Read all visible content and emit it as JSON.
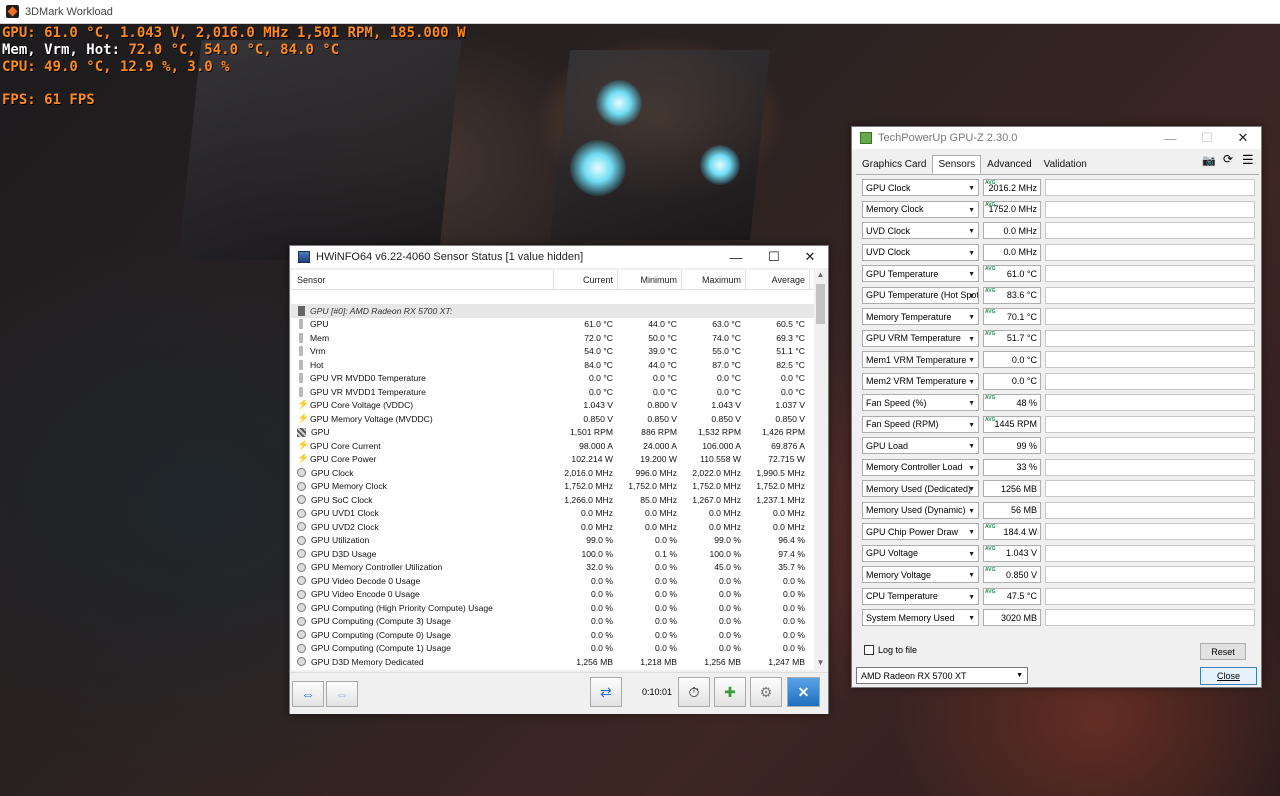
{
  "game_window": {
    "title": "3DMark Workload"
  },
  "osd": {
    "gpu_line": "GPU: 61.0 °C, 1.043 V, 2,016.0 MHz 1,501 RPM, 185.000 W",
    "mem_label": "Mem, Vrm, Hot:",
    "mem_values": " 72.0 °C, 54.0 °C, 84.0 °C",
    "cpu_line": "CPU: 49.0 °C, 12.9 %, 3.0 %",
    "fps_line": "FPS: 61 FPS"
  },
  "hwinfo": {
    "title": "HWiNFO64 v6.22-4060 Sensor Status [1 value hidden]",
    "columns": [
      "Sensor",
      "Current",
      "Minimum",
      "Maximum",
      "Average"
    ],
    "group": "GPU [#0]: AMD Radeon RX 5700 XT:",
    "rows": [
      {
        "icon": "therm",
        "name": "GPU",
        "cur": "61.0 °C",
        "min": "44.0 °C",
        "max": "63.0 °C",
        "avg": "60.5 °C"
      },
      {
        "icon": "therm",
        "name": "Mem",
        "cur": "72.0 °C",
        "min": "50.0 °C",
        "max": "74.0 °C",
        "avg": "69.3 °C"
      },
      {
        "icon": "therm",
        "name": "Vrm",
        "cur": "54.0 °C",
        "min": "39.0 °C",
        "max": "55.0 °C",
        "avg": "51.1 °C"
      },
      {
        "icon": "therm",
        "name": "Hot",
        "cur": "84.0 °C",
        "min": "44.0 °C",
        "max": "87.0 °C",
        "avg": "82.5 °C"
      },
      {
        "icon": "therm",
        "name": "GPU VR MVDD0 Temperature",
        "cur": "0.0 °C",
        "min": "0.0 °C",
        "max": "0.0 °C",
        "avg": "0.0 °C"
      },
      {
        "icon": "therm",
        "name": "GPU VR MVDD1 Temperature",
        "cur": "0.0 °C",
        "min": "0.0 °C",
        "max": "0.0 °C",
        "avg": "0.0 °C"
      },
      {
        "icon": "bolt",
        "name": "GPU Core Voltage (VDDC)",
        "cur": "1.043 V",
        "min": "0.800 V",
        "max": "1.043 V",
        "avg": "1.037 V"
      },
      {
        "icon": "bolt",
        "name": "GPU Memory Voltage (MVDDC)",
        "cur": "0.850 V",
        "min": "0.850 V",
        "max": "0.850 V",
        "avg": "0.850 V"
      },
      {
        "icon": "fan",
        "name": "GPU",
        "cur": "1,501 RPM",
        "min": "886 RPM",
        "max": "1,532 RPM",
        "avg": "1,426 RPM"
      },
      {
        "icon": "bolt",
        "name": "GPU Core Current",
        "cur": "98.000 A",
        "min": "24.000 A",
        "max": "106.000 A",
        "avg": "69.876 A"
      },
      {
        "icon": "bolt",
        "name": "GPU Core Power",
        "cur": "102.214 W",
        "min": "19.200 W",
        "max": "110.558 W",
        "avg": "72.715 W"
      },
      {
        "icon": "clock",
        "name": "GPU Clock",
        "cur": "2,016.0 MHz",
        "min": "996.0 MHz",
        "max": "2,022.0 MHz",
        "avg": "1,990.5 MHz"
      },
      {
        "icon": "clock",
        "name": "GPU Memory Clock",
        "cur": "1,752.0 MHz",
        "min": "1,752.0 MHz",
        "max": "1,752.0 MHz",
        "avg": "1,752.0 MHz"
      },
      {
        "icon": "clock",
        "name": "GPU SoC Clock",
        "cur": "1,266.0 MHz",
        "min": "85.0 MHz",
        "max": "1,267.0 MHz",
        "avg": "1,237.1 MHz"
      },
      {
        "icon": "clock",
        "name": "GPU UVD1 Clock",
        "cur": "0.0 MHz",
        "min": "0.0 MHz",
        "max": "0.0 MHz",
        "avg": "0.0 MHz"
      },
      {
        "icon": "clock",
        "name": "GPU UVD2 Clock",
        "cur": "0.0 MHz",
        "min": "0.0 MHz",
        "max": "0.0 MHz",
        "avg": "0.0 MHz"
      },
      {
        "icon": "clock",
        "name": "GPU Utilization",
        "cur": "99.0 %",
        "min": "0.0 %",
        "max": "99.0 %",
        "avg": "96.4 %"
      },
      {
        "icon": "clock",
        "name": "GPU D3D Usage",
        "cur": "100.0 %",
        "min": "0.1 %",
        "max": "100.0 %",
        "avg": "97.4 %"
      },
      {
        "icon": "clock",
        "name": "GPU Memory Controller Utilization",
        "cur": "32.0 %",
        "min": "0.0 %",
        "max": "45.0 %",
        "avg": "35.7 %"
      },
      {
        "icon": "clock",
        "name": "GPU Video Decode 0 Usage",
        "cur": "0.0 %",
        "min": "0.0 %",
        "max": "0.0 %",
        "avg": "0.0 %"
      },
      {
        "icon": "clock",
        "name": "GPU Video Encode 0 Usage",
        "cur": "0.0 %",
        "min": "0.0 %",
        "max": "0.0 %",
        "avg": "0.0 %"
      },
      {
        "icon": "clock",
        "name": "GPU Computing (High Priority Compute) Usage",
        "cur": "0.0 %",
        "min": "0.0 %",
        "max": "0.0 %",
        "avg": "0.0 %"
      },
      {
        "icon": "clock",
        "name": "GPU Computing (Compute 3) Usage",
        "cur": "0.0 %",
        "min": "0.0 %",
        "max": "0.0 %",
        "avg": "0.0 %"
      },
      {
        "icon": "clock",
        "name": "GPU Computing (Compute 0) Usage",
        "cur": "0.0 %",
        "min": "0.0 %",
        "max": "0.0 %",
        "avg": "0.0 %"
      },
      {
        "icon": "clock",
        "name": "GPU Computing (Compute 1) Usage",
        "cur": "0.0 %",
        "min": "0.0 %",
        "max": "0.0 %",
        "avg": "0.0 %"
      },
      {
        "icon": "clock",
        "name": "GPU D3D Memory Dedicated",
        "cur": "1,256 MB",
        "min": "1,218 MB",
        "max": "1,256 MB",
        "avg": "1,247 MB"
      }
    ],
    "footer": {
      "timer": "0:10:01"
    }
  },
  "gpuz": {
    "title": "TechPowerUp GPU-Z 2.30.0",
    "tabs": [
      "Graphics Card",
      "Sensors",
      "Advanced",
      "Validation"
    ],
    "active_tab": 1,
    "sensors": [
      {
        "name": "GPU Clock",
        "value": "2016.2 MHz",
        "avg": true,
        "level": 0.96
      },
      {
        "name": "Memory Clock",
        "value": "1752.0 MHz",
        "avg": true,
        "level": 0.45
      },
      {
        "name": "UVD Clock",
        "value": "0.0 MHz",
        "avg": false,
        "level": 0
      },
      {
        "name": "UVD Clock",
        "value": "0.0 MHz",
        "avg": false,
        "level": 0
      },
      {
        "name": "GPU Temperature",
        "value": "61.0 °C",
        "avg": true,
        "level": 0.8
      },
      {
        "name": "GPU Temperature (Hot Spot)",
        "value": "83.6 °C",
        "avg": true,
        "level": 0.85
      },
      {
        "name": "Memory Temperature",
        "value": "70.1 °C",
        "avg": true,
        "level": 0.55
      },
      {
        "name": "GPU VRM Temperature",
        "value": "51.7 °C",
        "avg": true,
        "level": 0.3
      },
      {
        "name": "Mem1 VRM Temperature",
        "value": "0.0 °C",
        "avg": false,
        "level": 0
      },
      {
        "name": "Mem2 VRM Temperature",
        "value": "0.0 °C",
        "avg": false,
        "level": 0
      },
      {
        "name": "Fan Speed (%)",
        "value": "48 %",
        "avg": true,
        "level": 0.45
      },
      {
        "name": "Fan Speed (RPM)",
        "value": "1445 RPM",
        "avg": true,
        "level": 0.5
      },
      {
        "name": "GPU Load",
        "value": "99 %",
        "avg": false,
        "level": 0.98
      },
      {
        "name": "Memory Controller Load",
        "value": "33 %",
        "avg": false,
        "level": 0.4
      },
      {
        "name": "Memory Used (Dedicated)",
        "value": "1256 MB",
        "avg": false,
        "level": 0.15
      },
      {
        "name": "Memory Used (Dynamic)",
        "value": "56 MB",
        "avg": false,
        "level": 0.08
      },
      {
        "name": "GPU Chip Power Draw",
        "value": "184.4 W",
        "avg": true,
        "level": 0.85
      },
      {
        "name": "GPU Voltage",
        "value": "1.043 V",
        "avg": true,
        "level": 0.6
      },
      {
        "name": "Memory Voltage",
        "value": "0.850 V",
        "avg": true,
        "level": 0.35
      },
      {
        "name": "CPU Temperature",
        "value": "47.5 °C",
        "avg": true,
        "level": 0.3
      },
      {
        "name": "System Memory Used",
        "value": "3020 MB",
        "avg": false,
        "level": 0.2
      }
    ],
    "log_label": "Log to file",
    "reset_label": "Reset",
    "device": "AMD Radeon RX 5700 XT",
    "close_label": "Close"
  }
}
